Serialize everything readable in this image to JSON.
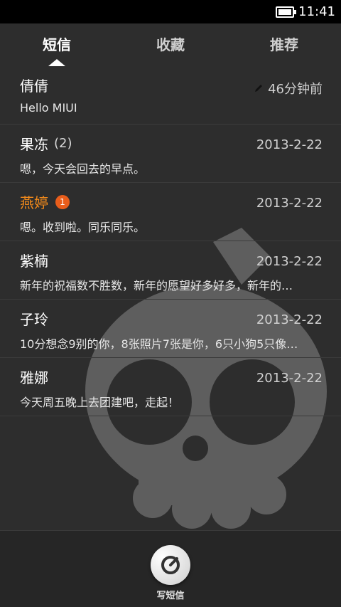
{
  "status_bar": {
    "time": "11:41"
  },
  "tabs": [
    {
      "label": "短信",
      "active": true
    },
    {
      "label": "收藏",
      "active": false
    },
    {
      "label": "推荐",
      "active": false
    }
  ],
  "conversations": [
    {
      "name": "倩倩",
      "count": "",
      "badge": "",
      "date": "46分钟前",
      "preview": "Hello MIUI",
      "draft": true
    },
    {
      "name": "果冻",
      "count": "(2)",
      "badge": "",
      "date": "2013-2-22",
      "preview": "嗯，今天会回去的早点。",
      "draft": false
    },
    {
      "name": "燕婷",
      "count": "",
      "badge": "1",
      "date": "2013-2-22",
      "preview": "嗯。收到啦。同乐同乐。",
      "draft": false,
      "unread": true
    },
    {
      "name": "紫楠",
      "count": "",
      "badge": "",
      "date": "2013-2-22",
      "preview": "新年的祝福数不胜数，新年的愿望好多好多，新年的…",
      "draft": false
    },
    {
      "name": "子玲",
      "count": "",
      "badge": "",
      "date": "2013-2-22",
      "preview": "10分想念9别的你，8张照片7张是你，6只小狗5只像…",
      "draft": false
    },
    {
      "name": "雅娜",
      "count": "",
      "badge": "",
      "date": "2013-2-22",
      "preview": "今天周五晚上去团建吧，走起！",
      "draft": false
    }
  ],
  "bottom": {
    "compose_label": "写短信"
  }
}
